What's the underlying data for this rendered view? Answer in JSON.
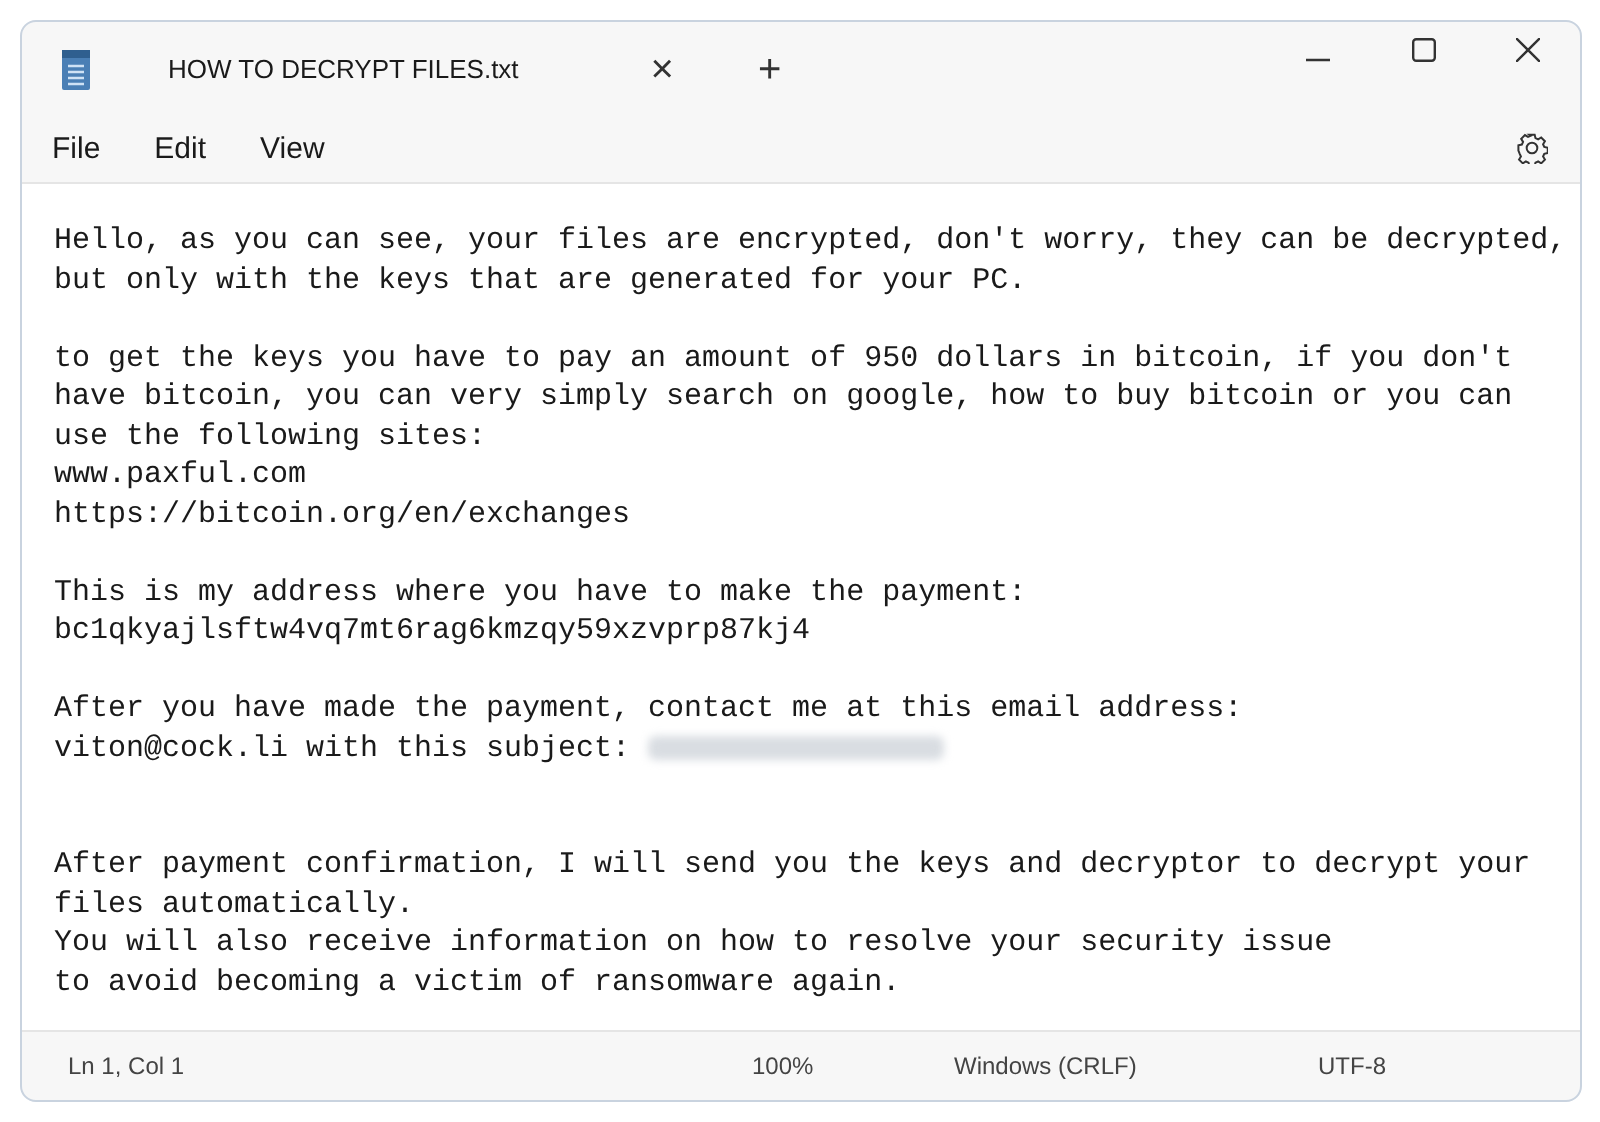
{
  "tab": {
    "title": "HOW TO DECRYPT FILES.txt",
    "close": "×",
    "new_tab": "+"
  },
  "menu": [
    "File",
    "Edit",
    "View"
  ],
  "paragraphs": [
    {
      "lines": [
        "Hello, as you can see, your files are encrypted, don't worry, they can be decrypted,",
        "but only with the keys that are generated for your PC."
      ]
    },
    {
      "lines": [
        "to get the keys you have to pay an amount of 950 dollars in bitcoin, if you don't",
        "have bitcoin, you can very simply search on google, how to buy bitcoin or you can",
        "use the following sites:",
        "www.paxful.com",
        "https://bitcoin.org/en/exchanges"
      ]
    },
    {
      "lines": [
        "This is my address where you have to make the payment:",
        "bc1qkyajlsftw4vq7mt6rag6kmzqy59xzvprp87kj4"
      ]
    },
    {
      "lines": [
        "After you have made the payment, contact me at this email address:",
        "viton@cock.li with this subject:"
      ],
      "redacted_tail": true
    },
    {
      "lines": [
        "After payment confirmation, I will send you the keys and decryptor to decrypt your",
        "files automatically.",
        "You will also receive information on how to resolve your security issue",
        "to avoid becoming a victim of ransomware again."
      ],
      "extra_gap": true
    }
  ],
  "status_bar": {
    "position": "Ln 1, Col 1",
    "zoom": "100%",
    "line_endings": "Windows (CRLF)",
    "encoding": "UTF-8"
  }
}
